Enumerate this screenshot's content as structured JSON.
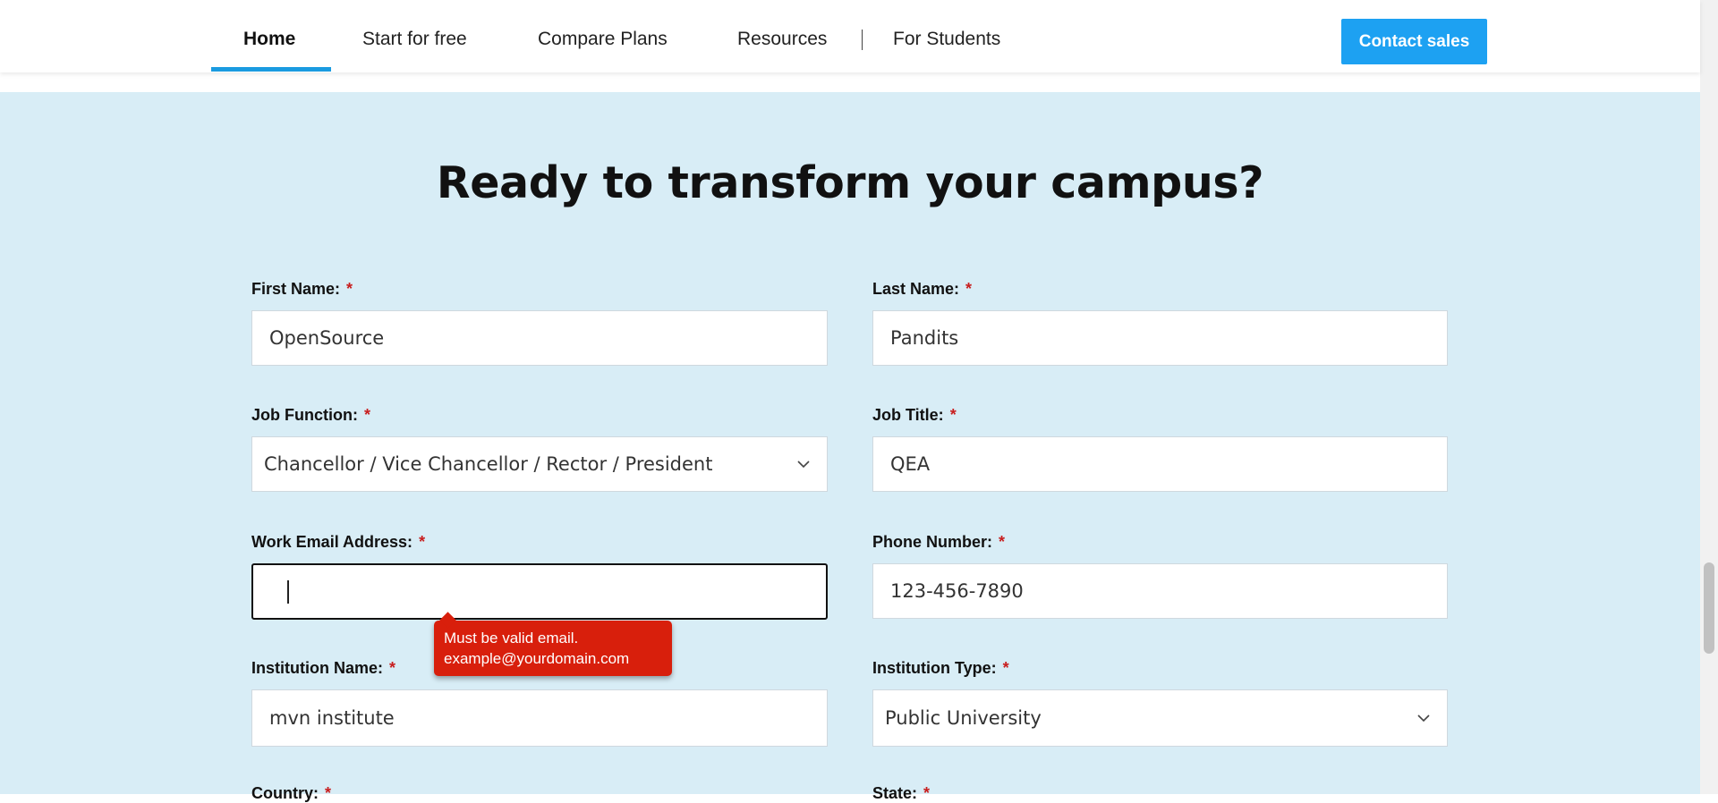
{
  "nav": {
    "items": [
      {
        "label": "Home",
        "active": true
      },
      {
        "label": "Start for free"
      },
      {
        "label": "Compare Plans"
      },
      {
        "label": "Resources"
      },
      {
        "label": "For Students"
      }
    ],
    "cta_label": "Contact sales"
  },
  "heading": "Ready to transform your campus?",
  "form": {
    "first_name": {
      "label": "First Name:",
      "required": "*",
      "value": "OpenSource"
    },
    "last_name": {
      "label": "Last Name:",
      "required": "*",
      "value": "Pandits"
    },
    "job_function": {
      "label": "Job Function:",
      "required": "*",
      "value": "Chancellor / Vice Chancellor / Rector / President"
    },
    "job_title": {
      "label": "Job Title:",
      "required": "*",
      "value": "QEA"
    },
    "work_email": {
      "label": "Work Email Address:",
      "required": "*",
      "value": ""
    },
    "phone": {
      "label": "Phone Number:",
      "required": "*",
      "value": "123-456-7890"
    },
    "institution_name": {
      "label": "Institution Name:",
      "required": "*",
      "value": "mvn institute"
    },
    "institution_type": {
      "label": "Institution Type:",
      "required": "*",
      "value": "Public University"
    },
    "country": {
      "label": "Country:",
      "required": "*"
    },
    "state": {
      "label": "State:",
      "required": "*"
    }
  },
  "error_tooltip": {
    "line1": "Must be valid email.",
    "line2": "example@yourdomain.com"
  },
  "colors": {
    "accent": "#1a9be0",
    "cta": "#1da1f2",
    "band": "#d8edf6",
    "error": "#d81f0c",
    "required": "#c81e1e"
  },
  "icons": {
    "select_arrow": "chevron-down-icon"
  }
}
